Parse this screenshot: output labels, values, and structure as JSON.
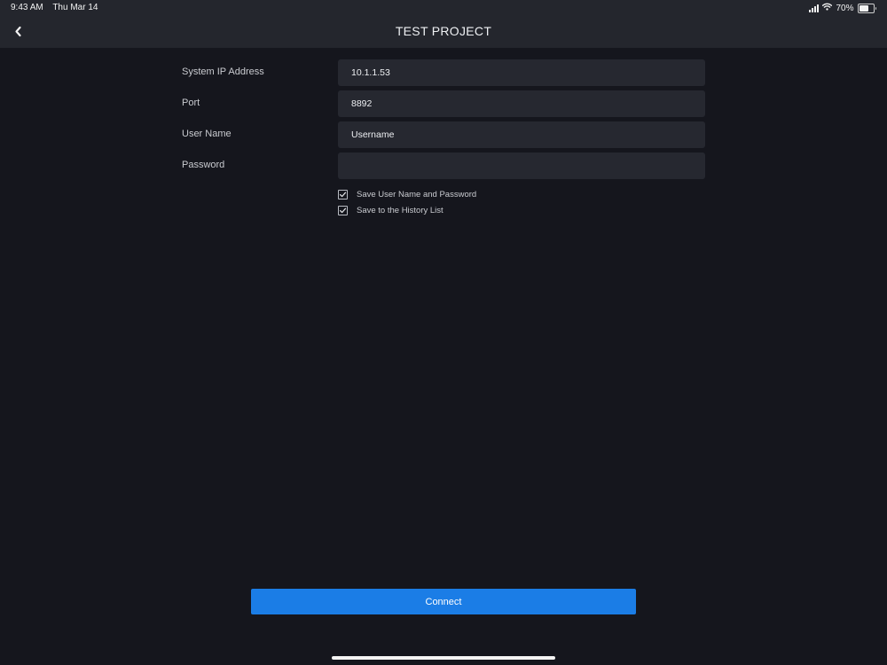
{
  "status_bar": {
    "time": "9:43 AM",
    "date": "Thu Mar 14",
    "battery": "70%",
    "battery_level": 0.7,
    "icons": [
      "signal-icon",
      "wifi-icon",
      "battery-icon"
    ]
  },
  "header": {
    "title": "TEST PROJECT",
    "back_icon": "chevron-left-icon"
  },
  "form": {
    "ip": {
      "label": "System IP Address",
      "value": "10.1.1.53"
    },
    "port": {
      "label": "Port",
      "value": "8892"
    },
    "username": {
      "label": "User Name",
      "value": "Username"
    },
    "password": {
      "label": "Password",
      "value": ""
    }
  },
  "options": {
    "save_credentials": {
      "label": "Save User Name and Password",
      "checked": true
    },
    "save_history": {
      "label": "Save to the History List",
      "checked": true
    }
  },
  "connect_label": "Connect",
  "colors": {
    "background": "#15161d",
    "header": "#24262d",
    "field": "#262830",
    "accent": "#1b7de6"
  }
}
